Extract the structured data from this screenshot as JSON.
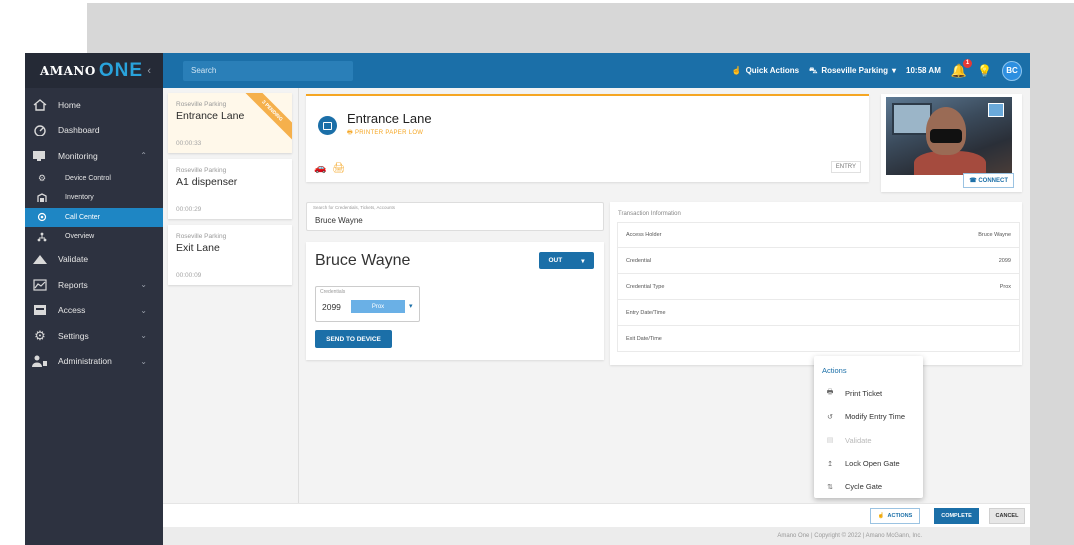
{
  "brand": {
    "name": "AMANO",
    "suffix": "ONE",
    "collapse_icon": "chevron-left-icon"
  },
  "sidebar": {
    "items": [
      {
        "label": "Home",
        "icon": "home-icon"
      },
      {
        "label": "Dashboard",
        "icon": "dashboard-icon"
      },
      {
        "label": "Monitoring",
        "icon": "monitor-icon",
        "expanded": true
      },
      {
        "label": "Device Control",
        "icon": "device-icon",
        "sub": true
      },
      {
        "label": "Inventory",
        "icon": "inventory-icon",
        "sub": true
      },
      {
        "label": "Call Center",
        "icon": "headset-icon",
        "sub": true,
        "active": true
      },
      {
        "label": "Overview",
        "icon": "overview-icon",
        "sub": true
      },
      {
        "label": "Validate",
        "icon": "validate-icon"
      },
      {
        "label": "Reports",
        "icon": "reports-icon",
        "chevron": true
      },
      {
        "label": "Access",
        "icon": "access-icon",
        "chevron": true
      },
      {
        "label": "Settings",
        "icon": "settings-icon",
        "chevron": true
      },
      {
        "label": "Administration",
        "icon": "admin-icon",
        "chevron": true
      }
    ]
  },
  "topbar": {
    "search_placeholder": "Search",
    "quick_actions": "Quick Actions",
    "location": "Roseville Parking",
    "time": "10:58 AM",
    "notification_count": "1",
    "user_initials": "BC"
  },
  "lanes": [
    {
      "location": "Roseville Parking",
      "name": "Entrance Lane",
      "time": "00:00:33",
      "selected": true,
      "ribbon": "3 PENDING"
    },
    {
      "location": "Roseville Parking",
      "name": "A1 dispenser",
      "time": "00:00:29"
    },
    {
      "location": "Roseville Parking",
      "name": "Exit Lane",
      "time": "00:00:09"
    }
  ],
  "lane_panel": {
    "title": "Entrance Lane",
    "warning": "PRINTER PAPER LOW",
    "tag": "ENTRY"
  },
  "camera": {
    "connect_label": "CONNECT"
  },
  "search_credentials": {
    "label": "Search for Credentials, Tickets, Accounts",
    "value": "Bruce Wayne"
  },
  "person": {
    "name": "Bruce Wayne",
    "direction": "OUT",
    "credentials_label": "Credentials",
    "credential_number": "2099",
    "credential_type": "Prox",
    "send_label": "SEND TO DEVICE"
  },
  "transaction": {
    "header": "Transaction Information",
    "rows": [
      {
        "label": "Access Holder",
        "value": "Bruce Wayne"
      },
      {
        "label": "Credential",
        "value": "2099"
      },
      {
        "label": "Credential Type",
        "value": "Prox"
      },
      {
        "label": "Entry Date/Time",
        "value": ""
      },
      {
        "label": "Exit Date/Time",
        "value": ""
      }
    ]
  },
  "actions_menu": {
    "title": "Actions",
    "items": [
      {
        "label": "Print Ticket",
        "icon": "printer-icon"
      },
      {
        "label": "Modify Entry Time",
        "icon": "clock-icon"
      },
      {
        "label": "Validate",
        "icon": "validate-icon",
        "disabled": true
      },
      {
        "label": "Lock Open Gate",
        "icon": "gate-lock-icon"
      },
      {
        "label": "Cycle Gate",
        "icon": "gate-cycle-icon"
      }
    ]
  },
  "bottom_bar": {
    "actions_label": "ACTIONS",
    "complete_label": "COMPLETE",
    "cancel_label": "CANCEL"
  },
  "footer": {
    "text": "Amano One | Copyright © 2022 | Amano McGann, Inc."
  },
  "colors": {
    "primary": "#1b6fa8",
    "sidebar": "#2d3240",
    "accent": "#f5a623",
    "active": "#1e86c4"
  }
}
